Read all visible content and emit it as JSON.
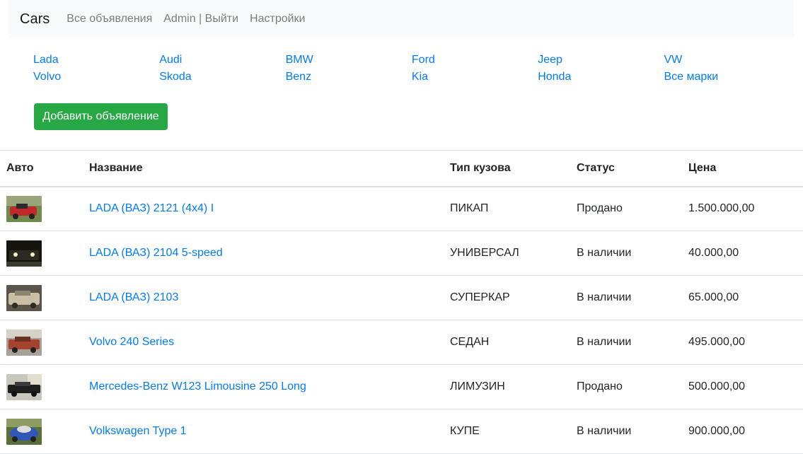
{
  "navbar": {
    "brand": "Cars",
    "links": [
      "Все объявления",
      "Admin | Выйти",
      "Настройки"
    ]
  },
  "brands": [
    "Lada",
    "Audi",
    "BMW",
    "Ford",
    "Jeep",
    "VW",
    "Volvo",
    "Skoda",
    "Benz",
    "Kia",
    "Honda",
    "Все марки"
  ],
  "add_button": "Добавить объявление",
  "table": {
    "headers": [
      "Авто",
      "Название",
      "Тип кузова",
      "Статус",
      "Цена"
    ],
    "rows": [
      {
        "name": "LADA (ВАЗ) 2121 (4x4) I",
        "body": "ПИКАП",
        "status": "Продано",
        "price": "1.500.000,00"
      },
      {
        "name": "LADA (ВАЗ) 2104 5-speed",
        "body": "УНИВЕРСАЛ",
        "status": "В наличии",
        "price": "40.000,00"
      },
      {
        "name": "LADA (ВАЗ) 2103",
        "body": "СУПЕРКАР",
        "status": "В наличии",
        "price": "65.000,00"
      },
      {
        "name": "Volvo 240 Series",
        "body": "СЕДАН",
        "status": "В наличии",
        "price": "495.000,00"
      },
      {
        "name": "Mercedes-Benz W123 Limousine 250 Long",
        "body": "ЛИМУЗИН",
        "status": "Продано",
        "price": "500.000,00"
      },
      {
        "name": "Volkswagen Type 1",
        "body": "КУПЕ",
        "status": "В наличии",
        "price": "900.000,00"
      }
    ]
  },
  "colors": {
    "link": "#007bff",
    "success": "#28a745",
    "navbar_bg": "#f8f9fa"
  }
}
